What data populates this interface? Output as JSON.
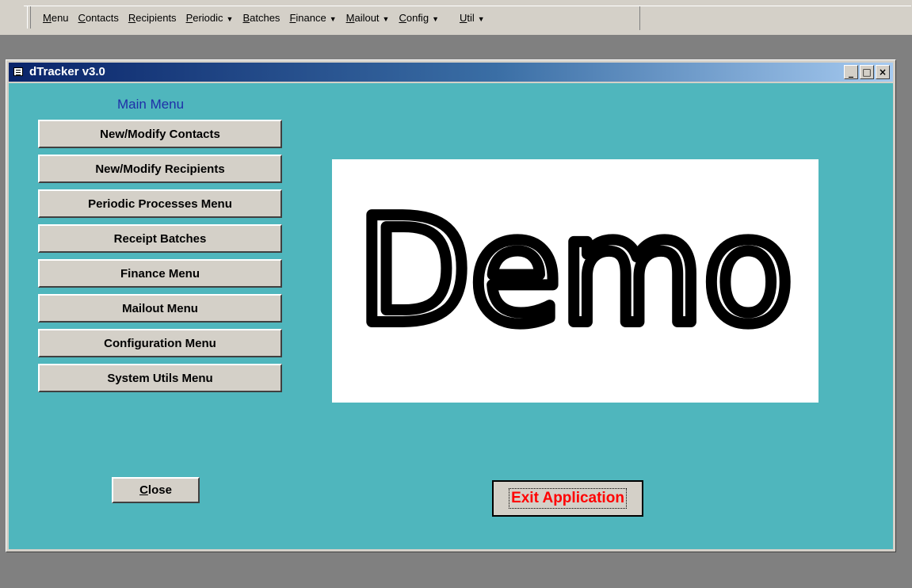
{
  "menubar": {
    "items": [
      {
        "label": "Menu",
        "dropdown": false
      },
      {
        "label": "Contacts",
        "dropdown": false
      },
      {
        "label": "Recipients",
        "dropdown": false
      },
      {
        "label": "Periodic",
        "dropdown": true
      },
      {
        "label": "Batches",
        "dropdown": false
      },
      {
        "label": "Finance",
        "dropdown": true
      },
      {
        "label": "Mailout",
        "dropdown": true
      },
      {
        "label": "Config",
        "dropdown": true
      },
      {
        "label": "Util",
        "dropdown": true
      }
    ]
  },
  "window": {
    "title": "dTracker v3.0",
    "controls": {
      "minimize": "_",
      "maximize": "□",
      "close": "×"
    }
  },
  "main": {
    "menu_label": "Main Menu",
    "buttons": [
      "New/Modify Contacts",
      "New/Modify Recipients",
      "Periodic Processes Menu",
      "Receipt Batches",
      "Finance Menu",
      "Mailout Menu",
      "Configuration Menu",
      "System Utils Menu"
    ],
    "logo_text": "Demo",
    "close_label": "Close",
    "exit_label": "Exit Application"
  },
  "colors": {
    "client_bg": "#4fb6bd",
    "title_start": "#0a246a",
    "exit_text": "#ff0000",
    "menu_label": "#1f2fa8"
  }
}
